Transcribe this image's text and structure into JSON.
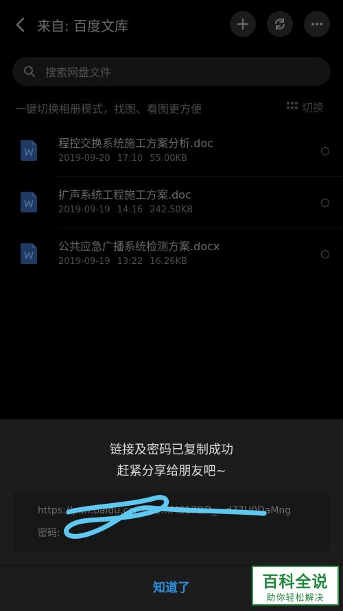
{
  "header": {
    "title": "来自: 百度文库"
  },
  "search": {
    "placeholder": "搜索网盘文件"
  },
  "tip": {
    "text": "一键切换相册模式，找图、看图更方便",
    "switch_label": "切换"
  },
  "files": [
    {
      "name": "程控交换系统施工方案分析.doc",
      "meta": "2019-09-20 17:10 55.00KB",
      "type": "word-file-icon"
    },
    {
      "name": "扩声系统工程施工方案.doc",
      "meta": "2019-09-19 14:16 242.50KB",
      "type": "word-file-icon"
    },
    {
      "name": "公共应急广播系统检测方案.docx",
      "meta": "2019-09-19 13:22 16.26KB",
      "type": "word-file-icon"
    }
  ],
  "dialog": {
    "line1": "链接及密码已复制成功",
    "line2": "赶紧分享给朋友吧~",
    "link_url": "https://pan.baidu.com/s/1...MS17DD_...d77U0DaMng",
    "link_pwd": "密码: ",
    "ok_label": "知道了"
  },
  "watermark": {
    "title": "百科全说",
    "subtitle": "助你轻松解决"
  },
  "colors": {
    "accent": "#2f8fdd",
    "scribble": "#5ec8f0",
    "watermark_green": "#1f8a3a"
  }
}
